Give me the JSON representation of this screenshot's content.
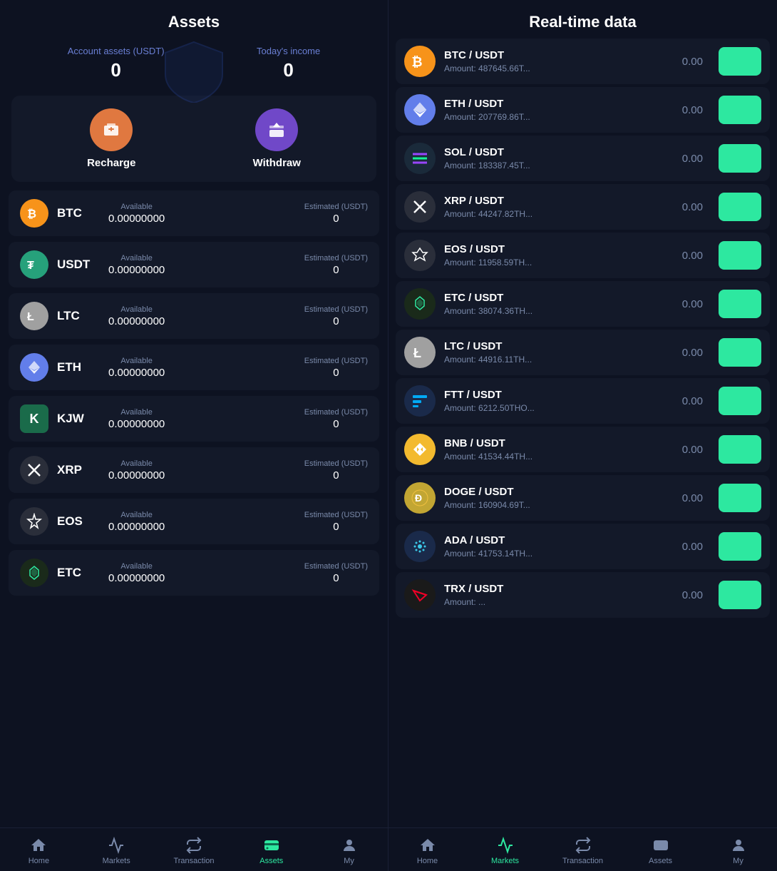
{
  "left": {
    "title": "Assets",
    "account_assets_label": "Account assets  (USDT)",
    "account_assets_value": "0",
    "todays_income_label": "Today's income",
    "todays_income_value": "0",
    "actions": [
      {
        "id": "recharge",
        "label": "Recharge",
        "icon": "💼",
        "color": "recharge"
      },
      {
        "id": "withdraw",
        "label": "Withdraw",
        "icon": "⬆",
        "color": "withdraw"
      }
    ],
    "assets": [
      {
        "id": "btc",
        "symbol": "BTC",
        "available": "0.00000000",
        "estimated": "0",
        "logo_color": "btc-logo",
        "logo_text": "₿"
      },
      {
        "id": "usdt",
        "symbol": "USDT",
        "available": "0.00000000",
        "estimated": "0",
        "logo_color": "usdt-logo",
        "logo_text": "₮"
      },
      {
        "id": "ltc",
        "symbol": "LTC",
        "available": "0.00000000",
        "estimated": "0",
        "logo_color": "ltc-logo",
        "logo_text": "Ł"
      },
      {
        "id": "eth",
        "symbol": "ETH",
        "available": "0.00000000",
        "estimated": "0",
        "logo_color": "eth-logo",
        "logo_text": "♦"
      },
      {
        "id": "kjw",
        "symbol": "KJW",
        "available": "0.00000000",
        "estimated": "0",
        "logo_color": "kjw-logo",
        "logo_text": "K"
      },
      {
        "id": "xrp",
        "symbol": "XRP",
        "available": "0.00000000",
        "estimated": "0",
        "logo_color": "xrp-logo",
        "logo_text": "✕"
      },
      {
        "id": "eos",
        "symbol": "EOS",
        "available": "0.00000000",
        "estimated": "0",
        "logo_color": "eos-logo",
        "logo_text": "◈"
      },
      {
        "id": "etc",
        "symbol": "ETC",
        "available": "0.00000000",
        "estimated": "0",
        "logo_color": "etc-logo",
        "logo_text": "♦"
      }
    ],
    "nav": [
      {
        "id": "home",
        "label": "Home",
        "active": false
      },
      {
        "id": "markets",
        "label": "Markets",
        "active": false
      },
      {
        "id": "transaction",
        "label": "Transaction",
        "active": false
      },
      {
        "id": "assets",
        "label": "Assets",
        "active": true
      },
      {
        "id": "my",
        "label": "My",
        "active": false
      }
    ]
  },
  "right": {
    "title": "Real-time data",
    "markets": [
      {
        "id": "btc",
        "pair": "BTC / USDT",
        "amount": "Amount: 487645.66T...",
        "price": "0.00",
        "logo_color": "btc-logo",
        "logo_text": "₿"
      },
      {
        "id": "eth",
        "pair": "ETH / USDT",
        "amount": "Amount: 207769.86T...",
        "price": "0.00",
        "logo_color": "eth-logo",
        "logo_text": "♦"
      },
      {
        "id": "sol",
        "pair": "SOL / USDT",
        "amount": "Amount: 183387.45T...",
        "price": "0.00",
        "logo_color": "sol-logo",
        "logo_text": "◎"
      },
      {
        "id": "xrp",
        "pair": "XRP / USDT",
        "amount": "Amount: 44247.82TH...",
        "price": "0.00",
        "logo_color": "xrp-logo",
        "logo_text": "✕"
      },
      {
        "id": "eos",
        "pair": "EOS / USDT",
        "amount": "Amount: 11958.59TH...",
        "price": "0.00",
        "logo_color": "eos-logo",
        "logo_text": "◈"
      },
      {
        "id": "etc",
        "pair": "ETC / USDT",
        "amount": "Amount: 38074.36TH...",
        "price": "0.00",
        "logo_color": "etc-logo",
        "logo_text": "♦"
      },
      {
        "id": "ltc",
        "pair": "LTC / USDT",
        "amount": "Amount: 44916.11TH...",
        "price": "0.00",
        "logo_color": "ltc-logo",
        "logo_text": "Ł"
      },
      {
        "id": "ftt",
        "pair": "FTT / USDT",
        "amount": "Amount: 6212.50THO...",
        "price": "0.00",
        "logo_color": "ftt-logo",
        "logo_text": "F"
      },
      {
        "id": "bnb",
        "pair": "BNB / USDT",
        "amount": "Amount: 41534.44TH...",
        "price": "0.00",
        "logo_color": "bnb-logo",
        "logo_text": "B"
      },
      {
        "id": "doge",
        "pair": "DOGE / USDT",
        "amount": "Amount: 160904.69T...",
        "price": "0.00",
        "logo_color": "doge-logo",
        "logo_text": "Ð"
      },
      {
        "id": "ada",
        "pair": "ADA / USDT",
        "amount": "Amount: 41753.14TH...",
        "price": "0.00",
        "logo_color": "ada-logo",
        "logo_text": "₳"
      },
      {
        "id": "trx",
        "pair": "TRX / USDT",
        "amount": "Amount: ...",
        "price": "0.00",
        "logo_color": "trx-logo",
        "logo_text": "T"
      }
    ],
    "nav": [
      {
        "id": "home",
        "label": "Home",
        "active": false
      },
      {
        "id": "markets",
        "label": "Markets",
        "active": true
      },
      {
        "id": "transaction",
        "label": "Transaction",
        "active": false
      },
      {
        "id": "assets",
        "label": "Assets",
        "active": false
      },
      {
        "id": "my",
        "label": "My",
        "active": false
      }
    ],
    "trade_btn_label": ""
  }
}
